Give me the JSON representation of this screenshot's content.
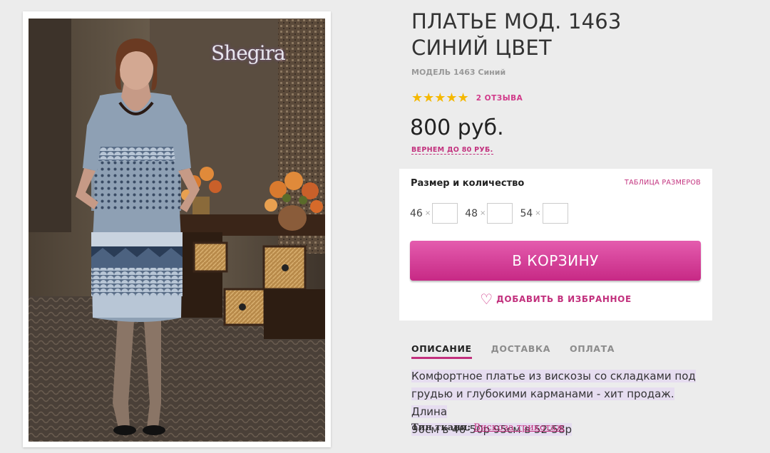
{
  "product": {
    "title_line1": "ПЛАТЬЕ МОД. 1463",
    "title_line2": "СИНИЙ ЦВЕТ",
    "subtitle": "МОДЕЛЬ 1463 Синий",
    "brand_logo": "Shegira",
    "rating": 5,
    "stars": "★★★★★",
    "reviews": "2 ОТЗЫВА",
    "price": "800 руб.",
    "cashback": "ВЕРНЕМ ДО 80 РУБ."
  },
  "order_box": {
    "title": "Размер и количество",
    "size_table_link": "ТАБЛИЦА РАЗМЕРОВ",
    "sizes": [
      {
        "label": "46",
        "multiplier": "×",
        "quantity": ""
      },
      {
        "label": "48",
        "multiplier": "×",
        "quantity": ""
      },
      {
        "label": "54",
        "multiplier": "×",
        "quantity": ""
      }
    ],
    "cart_button": "В КОРЗИНУ",
    "favorite_label": "ДОБАВИТЬ В ИЗБРАННОЕ",
    "favorite_icon": "heart-outline-icon"
  },
  "tabs": [
    {
      "label": "ОПИСАНИЕ",
      "active": true
    },
    {
      "label": "ДОСТАВКА",
      "active": false
    },
    {
      "label": "ОПЛАТА",
      "active": false
    }
  ],
  "description": {
    "line1": "Комфортное платье из вискозы со складками под",
    "line2": "грудью и глубокими карманами - хит продаж. Длина",
    "line3": "90см в 46-50р 95см в 52-58р",
    "fabric_label": "Тип ткани:",
    "fabric_value": "Вискоза трикотаж"
  },
  "colors": {
    "accent": "#c2307d",
    "button_top": "#e45cae",
    "button_bottom": "#c72985",
    "star": "#f5b800",
    "highlight": "#e6ddf0"
  }
}
